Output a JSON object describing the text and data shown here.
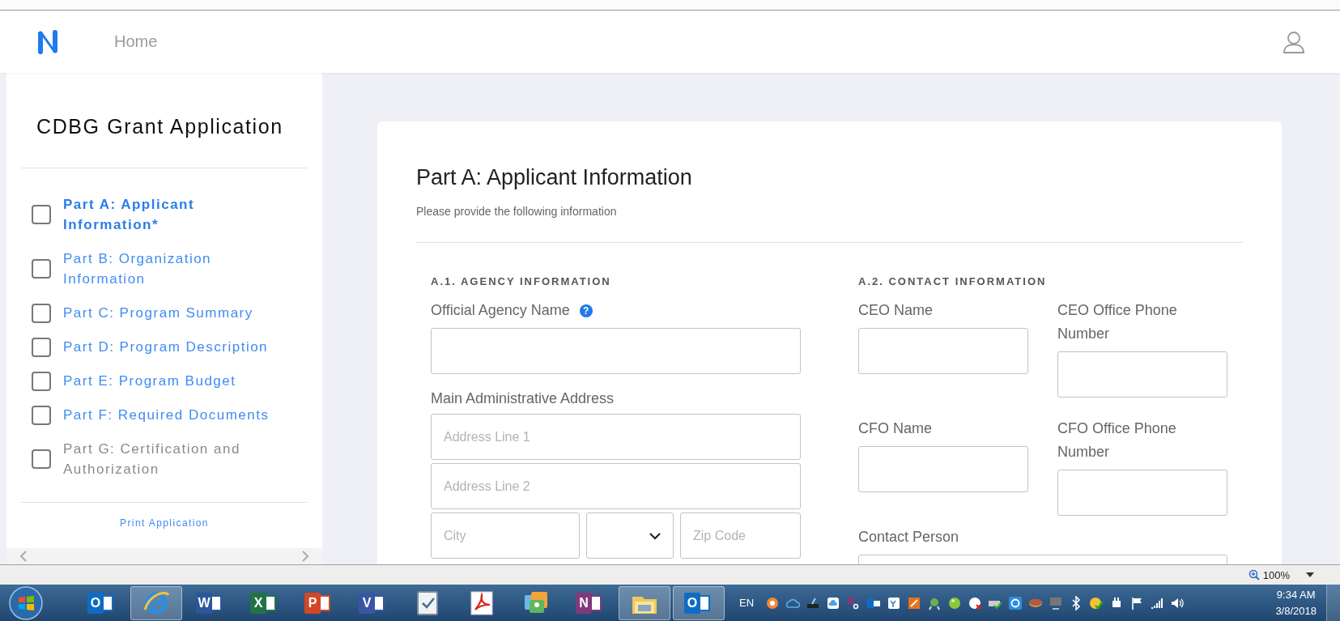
{
  "header": {
    "home_link": "Home"
  },
  "sidebar": {
    "title": "CDBG Grant Application",
    "parts": [
      {
        "label": "Part A: Applicant Information*",
        "checked": false,
        "selected": true,
        "disabled": false
      },
      {
        "label": "Part B: Organization Information",
        "checked": false,
        "selected": false,
        "disabled": false
      },
      {
        "label": "Part C: Program Summary",
        "checked": false,
        "selected": false,
        "disabled": false
      },
      {
        "label": "Part D: Program Description",
        "checked": false,
        "selected": false,
        "disabled": false
      },
      {
        "label": "Part E: Program Budget",
        "checked": false,
        "selected": false,
        "disabled": false
      },
      {
        "label": "Part F: Required Documents",
        "checked": false,
        "selected": false,
        "disabled": false
      },
      {
        "label": "Part G: Certification and Authorization",
        "checked": false,
        "selected": false,
        "disabled": true
      }
    ],
    "print_link": "Print Application"
  },
  "form": {
    "title": "Part A: Applicant Information",
    "subtitle": "Please provide the following information",
    "agency": {
      "heading": "A.1. AGENCY INFORMATION",
      "name_label": "Official Agency Name",
      "help_glyph": "?",
      "address_label": "Main Administrative Address",
      "address_lines": [
        {
          "placeholder": "Address Line 1"
        },
        {
          "placeholder": "Address Line 2"
        }
      ],
      "city": {
        "placeholder": "City"
      },
      "zip": {
        "placeholder": "Zip Code"
      }
    },
    "contact": {
      "heading": "A.2. CONTACT INFORMATION",
      "fields": [
        {
          "label": "CEO Name"
        },
        {
          "label": "CEO Office Phone Number"
        },
        {
          "label": "CFO Name"
        },
        {
          "label": "CFO Office Phone Number"
        }
      ],
      "contact_person_label": "Contact Person"
    }
  },
  "status_bar": {
    "zoom": "100%"
  },
  "taskbar": {
    "apps": [
      {
        "kind": "letter",
        "glyph": "O",
        "color": "#0f6cc4",
        "running": false
      },
      {
        "kind": "browser",
        "running": true
      },
      {
        "kind": "letter",
        "glyph": "W",
        "color": "#2b579a",
        "running": false
      },
      {
        "kind": "letter",
        "glyph": "X",
        "color": "#217346",
        "running": false
      },
      {
        "kind": "letter",
        "glyph": "P",
        "color": "#d24726",
        "running": false
      },
      {
        "kind": "letter",
        "glyph": "V",
        "color": "#3955a3",
        "running": false
      },
      {
        "kind": "check",
        "running": false
      },
      {
        "kind": "pdf",
        "running": false
      },
      {
        "kind": "photos",
        "running": false
      },
      {
        "kind": "letter",
        "glyph": "N",
        "color": "#80397b",
        "running": false
      },
      {
        "kind": "folder",
        "running": true
      },
      {
        "kind": "letter",
        "glyph": "O",
        "color": "#0f6cc4",
        "running": true
      }
    ],
    "language": "EN",
    "time": "9:34 AM",
    "date": "3/8/2018"
  }
}
